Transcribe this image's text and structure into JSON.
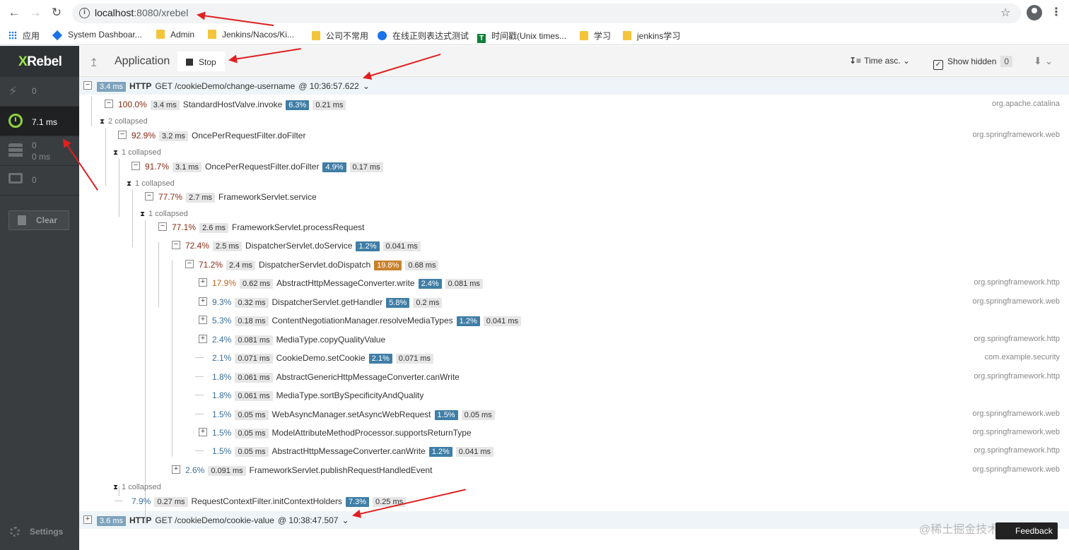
{
  "browser": {
    "url_host": "localhost",
    "url_rest": ":8080/xrebel",
    "bookmarks": [
      "应用",
      "System Dashboar...",
      "Admin",
      "Jenkins/Nacos/Ki...",
      "公司不常用",
      "在线正则表达式测试",
      "时间戳(Unix times...",
      "学习",
      "jenkins学习"
    ]
  },
  "sidebar": {
    "logo_x": "X",
    "logo_rest": "Rebel",
    "items": [
      {
        "value": "0",
        "icon": "lightning-icon"
      },
      {
        "value": "7.1 ms",
        "icon": "stopwatch-icon"
      },
      {
        "value": "0",
        "value2": "0 ms",
        "icon": "database-icon"
      },
      {
        "value": "0",
        "icon": "monitor-icon"
      }
    ],
    "clear_label": "Clear",
    "settings_label": "Settings"
  },
  "toolbar": {
    "title": "Application",
    "stop_label": "Stop",
    "sort_label": "Time asc.",
    "show_hidden_label": "Show hidden",
    "hidden_count": "0"
  },
  "requests": [
    {
      "duration": "3.4 ms",
      "proto": "HTTP",
      "endpoint": "GET /cookieDemo/change-username",
      "time": "@ 10:36:57.622"
    },
    {
      "duration": "3.6 ms",
      "proto": "HTTP",
      "endpoint": "GET /cookieDemo/cookie-value",
      "time": "@ 10:38:47.507"
    }
  ],
  "rows": [
    {
      "pct": "100.0%",
      "ms": "3.4 ms",
      "name": "StandardHostValve.invoke",
      "self": "6.3%",
      "self_ms": "0.21 ms",
      "pkg": "org.apache.catalina"
    },
    {
      "collapsed": "2 collapsed"
    },
    {
      "pct": "92.9%",
      "ms": "3.2 ms",
      "name": "OncePerRequestFilter.doFilter",
      "pkg": "org.springframework.web"
    },
    {
      "collapsed": "1 collapsed"
    },
    {
      "pct": "91.7%",
      "ms": "3.1 ms",
      "name": "OncePerRequestFilter.doFilter",
      "self": "4.9%",
      "self_ms": "0.17 ms"
    },
    {
      "collapsed": "1 collapsed"
    },
    {
      "pct": "77.7%",
      "ms": "2.7 ms",
      "name": "FrameworkServlet.service"
    },
    {
      "collapsed": "1 collapsed"
    },
    {
      "pct": "77.1%",
      "ms": "2.6 ms",
      "name": "FrameworkServlet.processRequest"
    },
    {
      "pct": "72.4%",
      "ms": "2.5 ms",
      "name": "DispatcherServlet.doService",
      "self": "1.2%",
      "self_ms": "0.041 ms"
    },
    {
      "pct": "71.2%",
      "ms": "2.4 ms",
      "name": "DispatcherServlet.doDispatch",
      "self": "19.8%",
      "self_ms": "0.68 ms"
    },
    {
      "pct": "17.9%",
      "ms": "0.62 ms",
      "name": "AbstractHttpMessageConverter.write",
      "self": "2.4%",
      "self_ms": "0.081 ms",
      "pkg": "org.springframework.http"
    },
    {
      "pct": "9.3%",
      "ms": "0.32 ms",
      "name": "DispatcherServlet.getHandler",
      "self": "5.8%",
      "self_ms": "0.2 ms",
      "pkg": "org.springframework.web"
    },
    {
      "pct": "5.3%",
      "ms": "0.18 ms",
      "name": "ContentNegotiationManager.resolveMediaTypes",
      "self": "1.2%",
      "self_ms": "0.041 ms"
    },
    {
      "pct": "2.4%",
      "ms": "0.081 ms",
      "name": "MediaType.copyQualityValue",
      "pkg": "org.springframework.http"
    },
    {
      "pct": "2.1%",
      "ms": "0.071 ms",
      "name": "CookieDemo.setCookie",
      "self": "2.1%",
      "self_ms": "0.071 ms",
      "pkg": "com.example.security"
    },
    {
      "pct": "1.8%",
      "ms": "0.061 ms",
      "name": "AbstractGenericHttpMessageConverter.canWrite",
      "pkg": "org.springframework.http"
    },
    {
      "pct": "1.8%",
      "ms": "0.061 ms",
      "name": "MediaType.sortBySpecificityAndQuality"
    },
    {
      "pct": "1.5%",
      "ms": "0.05 ms",
      "name": "WebAsyncManager.setAsyncWebRequest",
      "self": "1.5%",
      "self_ms": "0.05 ms",
      "pkg": "org.springframework.web"
    },
    {
      "pct": "1.5%",
      "ms": "0.05 ms",
      "name": "ModelAttributeMethodProcessor.supportsReturnType",
      "pkg": "org.springframework.web"
    },
    {
      "pct": "1.5%",
      "ms": "0.05 ms",
      "name": "AbstractHttpMessageConverter.canWrite",
      "self": "1.2%",
      "self_ms": "0.041 ms",
      "pkg": "org.springframework.http"
    },
    {
      "pct": "2.6%",
      "ms": "0.091 ms",
      "name": "FrameworkServlet.publishRequestHandledEvent",
      "pkg": "org.springframework.web"
    },
    {
      "collapsed": "1 collapsed"
    },
    {
      "pct": "7.9%",
      "ms": "0.27 ms",
      "name": "RequestContextFilter.initContextHolders",
      "self": "7.3%",
      "self_ms": "0.25 ms"
    }
  ],
  "feedback_label": "Feedback",
  "watermark": "@稀土掘金技术社区"
}
